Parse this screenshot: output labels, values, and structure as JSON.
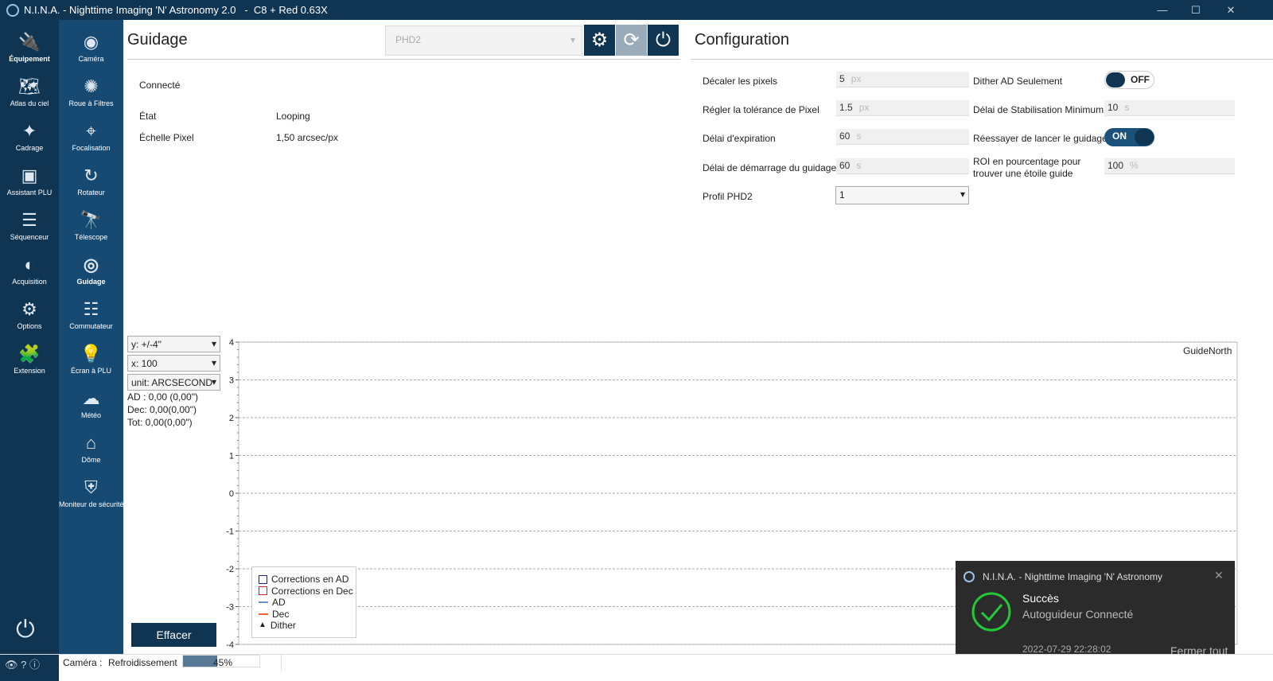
{
  "window": {
    "title": "N.I.N.A. - Nighttime Imaging 'N' Astronomy 2.0   -  C8 + Red 0.63X",
    "minimize": "—",
    "maximize": "☐",
    "close": "✕"
  },
  "sidebar": [
    {
      "label": "Équipement",
      "icon": "equipment-icon"
    },
    {
      "label": "Atlas du ciel",
      "icon": "sky-atlas-icon"
    },
    {
      "label": "Cadrage",
      "icon": "framing-icon"
    },
    {
      "label": "Assistant PLU",
      "icon": "flat-wizard-icon"
    },
    {
      "label": "Séquenceur",
      "icon": "sequencer-icon"
    },
    {
      "label": "Acquisition",
      "icon": "imaging-icon"
    },
    {
      "label": "Options",
      "icon": "options-icon"
    },
    {
      "label": "Extension",
      "icon": "plugin-icon"
    }
  ],
  "subnav": [
    {
      "label": "Caméra"
    },
    {
      "label": "Roue à Filtres"
    },
    {
      "label": "Focalisation"
    },
    {
      "label": "Rotateur"
    },
    {
      "label": "Télescope"
    },
    {
      "label": "Guidage"
    },
    {
      "label": "Commutateur"
    },
    {
      "label": "Écran à PLU"
    },
    {
      "label": "Météo"
    },
    {
      "label": "Dôme"
    },
    {
      "label": "Moniteur de sécurité"
    }
  ],
  "guiding": {
    "title": "Guidage",
    "device": "PHD2",
    "connected": "Connecté",
    "state_label": "État",
    "state": "Looping",
    "scale_label": "Échelle Pixel",
    "scale": "1,50 arcsec/px"
  },
  "config": {
    "title": "Configuration",
    "dither_pixels": {
      "label": "Décaler les pixels",
      "value": "5",
      "unit": "px"
    },
    "settle_tol": {
      "label": "Régler la tolérance de Pixel",
      "value": "1.5",
      "unit": "px"
    },
    "timeout": {
      "label": "Délai d'expiration",
      "value": "60",
      "unit": "s"
    },
    "start_delay": {
      "label": "Délai de démarrage du guidage",
      "value": "60",
      "unit": "s"
    },
    "profile": {
      "label": "Profil PHD2",
      "value": "1"
    },
    "dither_ra": {
      "label": "Dither AD Seulement",
      "value": "OFF"
    },
    "min_settle": {
      "label": "Délai de Stabilisation Minimum",
      "value": "10",
      "unit": "s"
    },
    "retry": {
      "label": "Réessayer de lancer le guidage",
      "value": "ON"
    },
    "roi": {
      "label": "ROI en pourcentage pour trouver une étoile guide",
      "value": "100",
      "unit": "%"
    }
  },
  "graph_controls": {
    "y": "y: +/-4\"",
    "x": "x: 100",
    "unit": "unit: ARCSECOND",
    "ra": "AD : 0,00 (0,00\")",
    "dec": "Dec: 0,00(0,00\")",
    "tot": "Tot: 0,00(0,00\")",
    "clear": "Effacer"
  },
  "chart_data": {
    "type": "line",
    "ylim": [
      -4,
      4
    ],
    "yticks": [
      "4",
      "3",
      "2",
      "1",
      "0",
      "-1",
      "-2",
      "-3",
      "-4"
    ],
    "annotation": "GuideNorth",
    "legend": [
      "Corrections en AD",
      "Corrections en Dec",
      "AD",
      "Dec",
      "Dither"
    ],
    "series": [
      {
        "name": "AD",
        "values": []
      },
      {
        "name": "Dec",
        "values": []
      }
    ],
    "colors": {
      "ra": "#6a8fd8",
      "dec": "#e8602c",
      "ra_corr": "#1a237e",
      "dec_corr": "#c62828"
    }
  },
  "toast": {
    "app": "N.I.N.A. - Nighttime Imaging 'N' Astronomy",
    "title": "Succès",
    "message": "Autoguideur Connecté",
    "time": "2022-07-29 22:28:02",
    "close_all": "Fermer tout"
  },
  "status": {
    "device": "Caméra :",
    "activity": "Refroidissement",
    "progress_text": "45%",
    "progress": 45
  }
}
